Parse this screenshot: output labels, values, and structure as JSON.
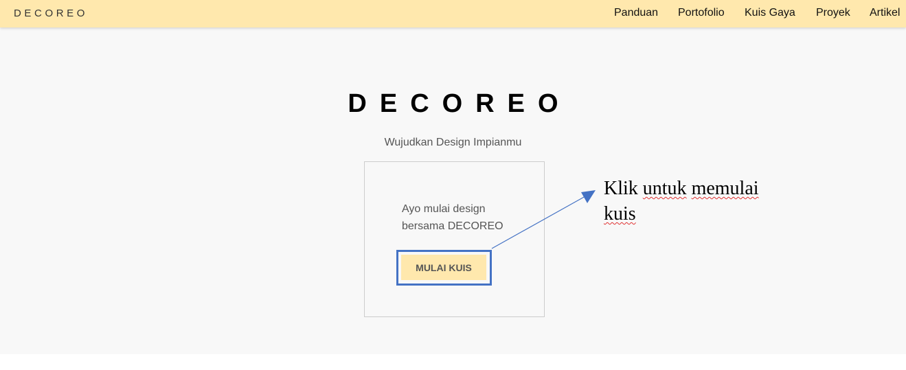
{
  "navbar": {
    "brand": "DECOREO",
    "items": [
      {
        "label": "Panduan"
      },
      {
        "label": "Portofolio"
      },
      {
        "label": "Kuis Gaya"
      },
      {
        "label": "Proyek"
      },
      {
        "label": "Artikel"
      }
    ]
  },
  "hero": {
    "title": "DECOREO",
    "subtitle": "Wujudkan Design Impianmu"
  },
  "card": {
    "line1": "Ayo mulai design",
    "line2": "bersama DECOREO",
    "button_label": "MULAI KUIS"
  },
  "annotation": {
    "word1": "Klik",
    "word2": "untuk",
    "word3": "memulai",
    "word4": "kuis",
    "arrow_color": "#4472c4"
  },
  "colors": {
    "navbar_bg": "#ffe8ad",
    "button_bg": "#ffe8ad",
    "highlight_border": "#4472c4",
    "page_bg": "#f8f8f8"
  }
}
